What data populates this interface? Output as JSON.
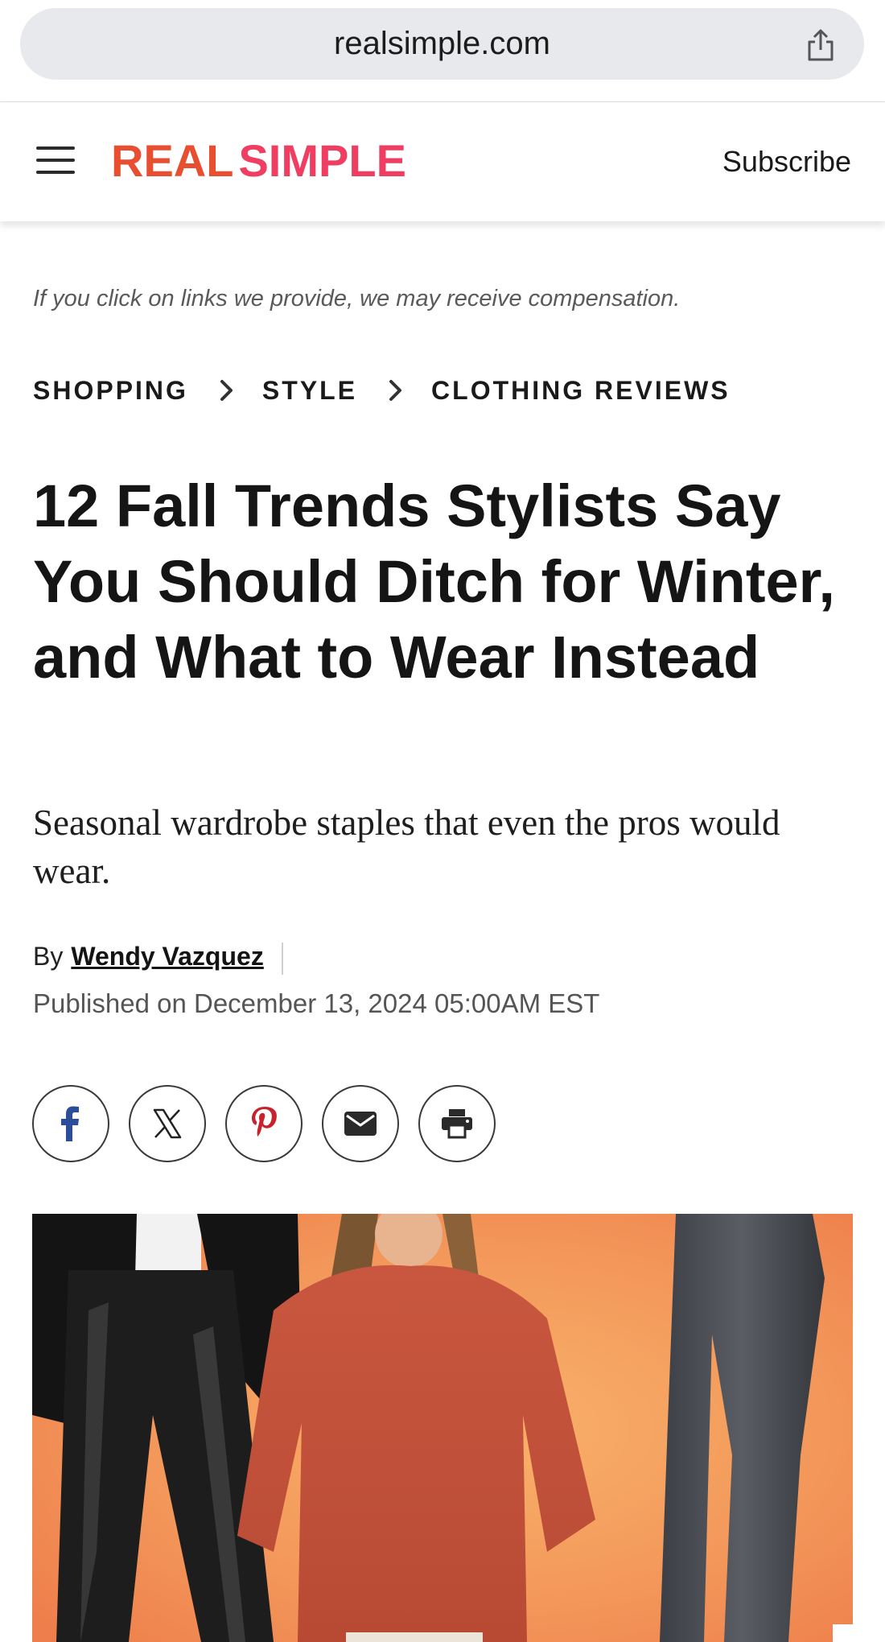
{
  "browser": {
    "url": "realsimple.com"
  },
  "header": {
    "logo_part1": "REAL",
    "logo_part2": "SIMPLE",
    "subscribe_label": "Subscribe"
  },
  "disclaimer": "If you click on links we provide, we may receive compensation.",
  "breadcrumb": [
    "SHOPPING",
    "STYLE",
    "CLOTHING REVIEWS"
  ],
  "article": {
    "title": "12 Fall Trends Stylists Say You Should Ditch for Winter, and What to Wear Instead",
    "dek": "Seasonal wardrobe staples that even the pros would wear.",
    "by_label": "By",
    "author": "Wendy Vazquez",
    "published": "Published on December 13, 2024 05:00AM EST"
  },
  "share_buttons": [
    "facebook-icon",
    "x-icon",
    "pinterest-icon",
    "email-icon",
    "print-icon"
  ],
  "colors": {
    "logo_real": "#e84f31",
    "logo_simple": "#ef3e62",
    "facebook": "#2c4d9a",
    "pinterest": "#c8232c",
    "hero_background": "#f3975a"
  }
}
